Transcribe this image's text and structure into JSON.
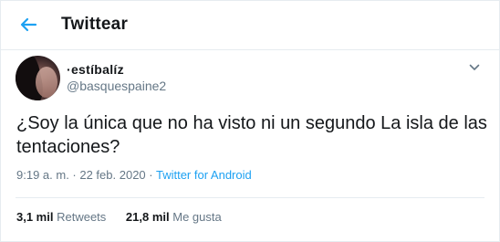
{
  "header": {
    "back_icon": "arrow-left-icon",
    "title": "Twittear"
  },
  "tweet": {
    "display_name": "·estíbalíz",
    "handle": "@basquespaine2",
    "text": "¿Soy la única que no ha visto ni un segundo La isla de las tentaciones?",
    "timestamp": "9:19 a. m. · 22 feb. 2020 · ",
    "source": "Twitter for Android",
    "retweets_count": "3,1 mil",
    "retweets_label": "Retweets",
    "likes_count": "21,8 mil",
    "likes_label": "Me gusta",
    "more_icon": "chevron-down-icon"
  },
  "colors": {
    "accent": "#1da1f2",
    "text": "#14171a",
    "secondary": "#657786",
    "border": "#e6ecf0"
  }
}
